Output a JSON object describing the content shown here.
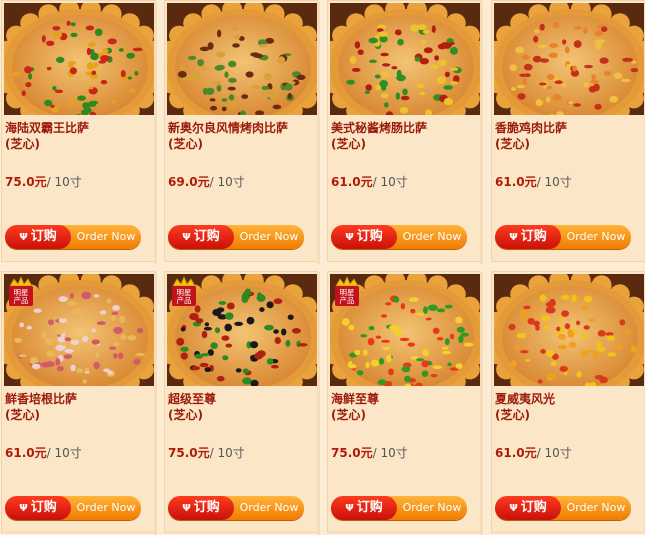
{
  "items": [
    {
      "name": "海陆双霸王比萨",
      "sub": "(芝心)",
      "price": "75.0元",
      "size": "/ 10寸",
      "star": false,
      "toppings": [
        "#c9261b",
        "#2f8a1e",
        "#e5a21a"
      ]
    },
    {
      "name": "新奥尔良风情烤肉比萨",
      "sub": "(芝心)",
      "price": "69.0元",
      "size": "/ 10寸",
      "star": false,
      "toppings": [
        "#6b2a12",
        "#4a8a2a",
        "#d8a03a"
      ]
    },
    {
      "name": "美式秘酱烤肠比萨",
      "sub": "(芝心)",
      "price": "61.0元",
      "size": "/ 10寸",
      "star": false,
      "toppings": [
        "#b01f10",
        "#2e8f25",
        "#eec22a"
      ]
    },
    {
      "name": "香脆鸡肉比萨",
      "sub": "(芝心)",
      "price": "61.0元",
      "size": "/ 10寸",
      "star": false,
      "toppings": [
        "#c5301a",
        "#e8832a",
        "#f0c040"
      ]
    },
    {
      "name": "鲜香培根比萨",
      "sub": "(芝心)",
      "price": "61.0元",
      "size": "/ 10寸",
      "star": true,
      "toppings": [
        "#d25a6a",
        "#f0d0d0",
        "#e9b85a"
      ]
    },
    {
      "name": "超级至尊",
      "sub": "(芝心)",
      "price": "75.0元",
      "size": "/ 10寸",
      "star": true,
      "toppings": [
        "#1a1a1a",
        "#2c8a22",
        "#b02010"
      ]
    },
    {
      "name": "海鲜至尊",
      "sub": "(芝心)",
      "price": "75.0元",
      "size": "/ 10寸",
      "star": true,
      "toppings": [
        "#e63a1a",
        "#2f9a22",
        "#f6d02a"
      ]
    },
    {
      "name": "夏威夷风光",
      "sub": "(芝心)",
      "price": "61.0元",
      "size": "/ 10寸",
      "star": false,
      "toppings": [
        "#f5c21a",
        "#d83a1a",
        "#f0a020"
      ]
    }
  ],
  "labels": {
    "order_cn": "订购",
    "order_en": "Order Now",
    "badge_line1": "明星",
    "badge_line2": "产品"
  },
  "colors": {
    "accent": "#9b1a0a",
    "button_red": "#d8170c",
    "button_orange": "#f58a00"
  }
}
